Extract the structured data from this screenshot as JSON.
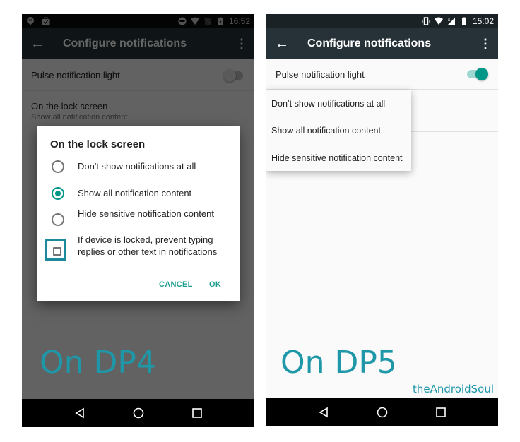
{
  "left_screen": {
    "status_bar": {
      "left_icons": [
        "hangouts-icon",
        "work-briefcase-icon"
      ],
      "right_icons": [
        "do-not-disturb-icon",
        "wifi-icon",
        "no-sim-icon",
        "battery-charging-icon"
      ],
      "time": "16:52"
    },
    "toolbar": {
      "back_icon": "←",
      "title": "Configure notifications",
      "more_icon": "⋮"
    },
    "settings": [
      {
        "title": "Pulse notification light",
        "switch_on": false
      },
      {
        "title": "On the lock screen",
        "subtitle": "Show all notification content"
      }
    ],
    "dialog": {
      "title": "On the lock screen",
      "options": [
        {
          "label": "Don't show notifications at all",
          "selected": false
        },
        {
          "label": "Show all notification content",
          "selected": true
        },
        {
          "label": "Hide sensitive notification content",
          "selected": false
        }
      ],
      "checkbox": {
        "label": "If device is locked, prevent typing replies or other text in notifications",
        "checked": false
      },
      "cancel_label": "CANCEL",
      "ok_label": "OK"
    },
    "caption": "On DP4"
  },
  "right_screen": {
    "status_bar": {
      "right_icons": [
        "vibrate-icon",
        "wifi-icon",
        "signal-icon",
        "battery-icon"
      ],
      "time": "15:02"
    },
    "toolbar": {
      "back_icon": "←",
      "title": "Configure notifications",
      "more_icon": "⋮"
    },
    "settings": [
      {
        "title": "Pulse notification light",
        "switch_on": true
      }
    ],
    "popup_menu": {
      "items": [
        "Don’t show notifications at all",
        "Show all notification content",
        "Hide sensitive notification content"
      ]
    },
    "caption": "On DP5",
    "watermark": "theAndroidSoul"
  },
  "colors": {
    "accent": "#009688",
    "caption": "#1e98a8",
    "toolbar": "#263238"
  }
}
